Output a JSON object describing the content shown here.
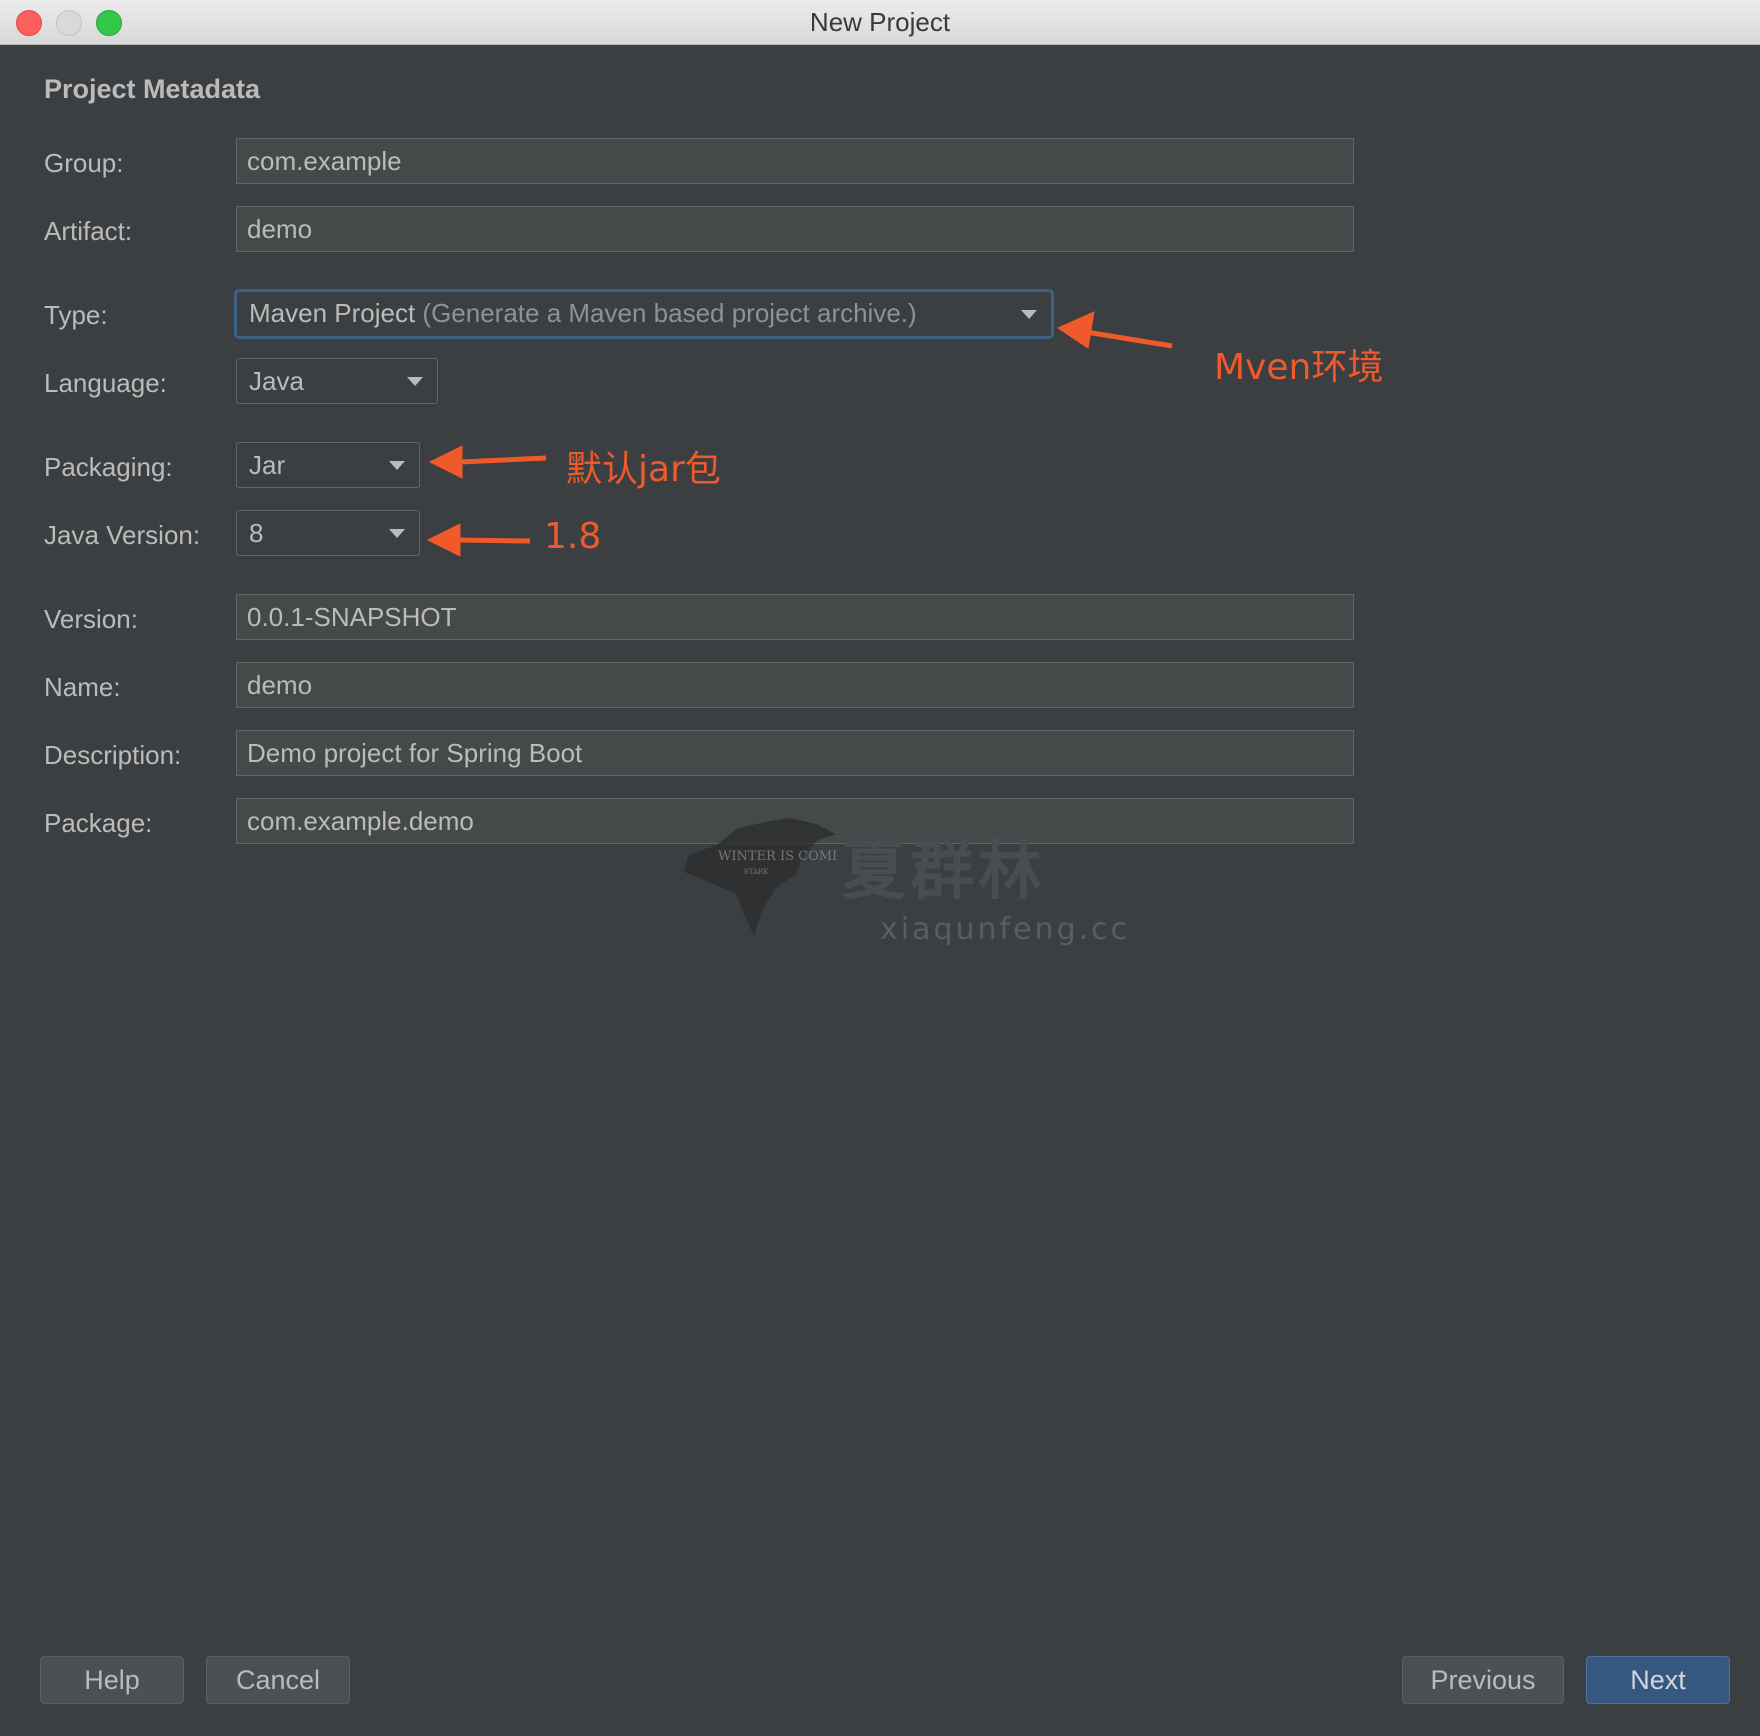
{
  "window": {
    "title": "New Project"
  },
  "section": {
    "title": "Project Metadata"
  },
  "fields": {
    "group": {
      "label": "Group:",
      "value": "com.example"
    },
    "artifact": {
      "label": "Artifact:",
      "value": "demo"
    },
    "type": {
      "label": "Type:",
      "value": "Maven Project",
      "hint": "(Generate a Maven based project archive.)"
    },
    "language": {
      "label": "Language:",
      "value": "Java"
    },
    "packaging": {
      "label": "Packaging:",
      "value": "Jar"
    },
    "java_version": {
      "label": "Java Version:",
      "value": "8"
    },
    "version": {
      "label": "Version:",
      "value": "0.0.1-SNAPSHOT"
    },
    "name": {
      "label": "Name:",
      "value": "demo"
    },
    "description": {
      "label": "Description:",
      "value": "Demo project for Spring Boot"
    },
    "package": {
      "label": "Package:",
      "value": "com.example.demo"
    }
  },
  "annotations": {
    "type_note": "Mven环境",
    "packaging_note": "默认jar包",
    "java_version_note": "1.8",
    "color": "#f05a2a"
  },
  "watermark": {
    "logo_text": "WINTER IS COMING",
    "logo_sub": "STARK",
    "site_cn": "夏群林",
    "site_url": "xiaqunfeng.cc"
  },
  "buttons": {
    "help": "Help",
    "cancel": "Cancel",
    "previous": "Previous",
    "next": "Next"
  },
  "colors": {
    "background": "#3c3f41",
    "field_bg": "#45494a",
    "primary_button": "#365880",
    "focus_border": "#3d6185"
  }
}
